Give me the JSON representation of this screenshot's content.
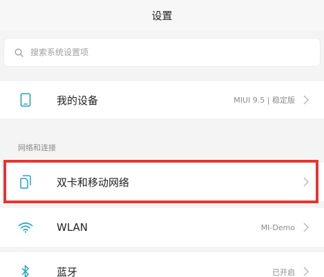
{
  "header": {
    "title": "设置"
  },
  "search": {
    "placeholder": "搜索系统设置项",
    "value": ""
  },
  "rows": {
    "device": {
      "label": "我的设备",
      "value": "MIUI 9.5 | 稳定版",
      "icon": "phone-icon"
    },
    "section_network": "网络和连接",
    "dual_sim": {
      "label": "双卡和移动网络",
      "icon": "sim-card-icon"
    },
    "wlan": {
      "label": "WLAN",
      "value": "MI-Demo",
      "icon": "wifi-icon"
    },
    "bluetooth": {
      "label": "蓝牙",
      "value": "已开启",
      "icon": "bluetooth-icon"
    }
  },
  "colors": {
    "accent": "#1ba3c6",
    "highlight": "#e8332f",
    "chevron": "#b5b5b5",
    "background": "#f4f4f4"
  }
}
